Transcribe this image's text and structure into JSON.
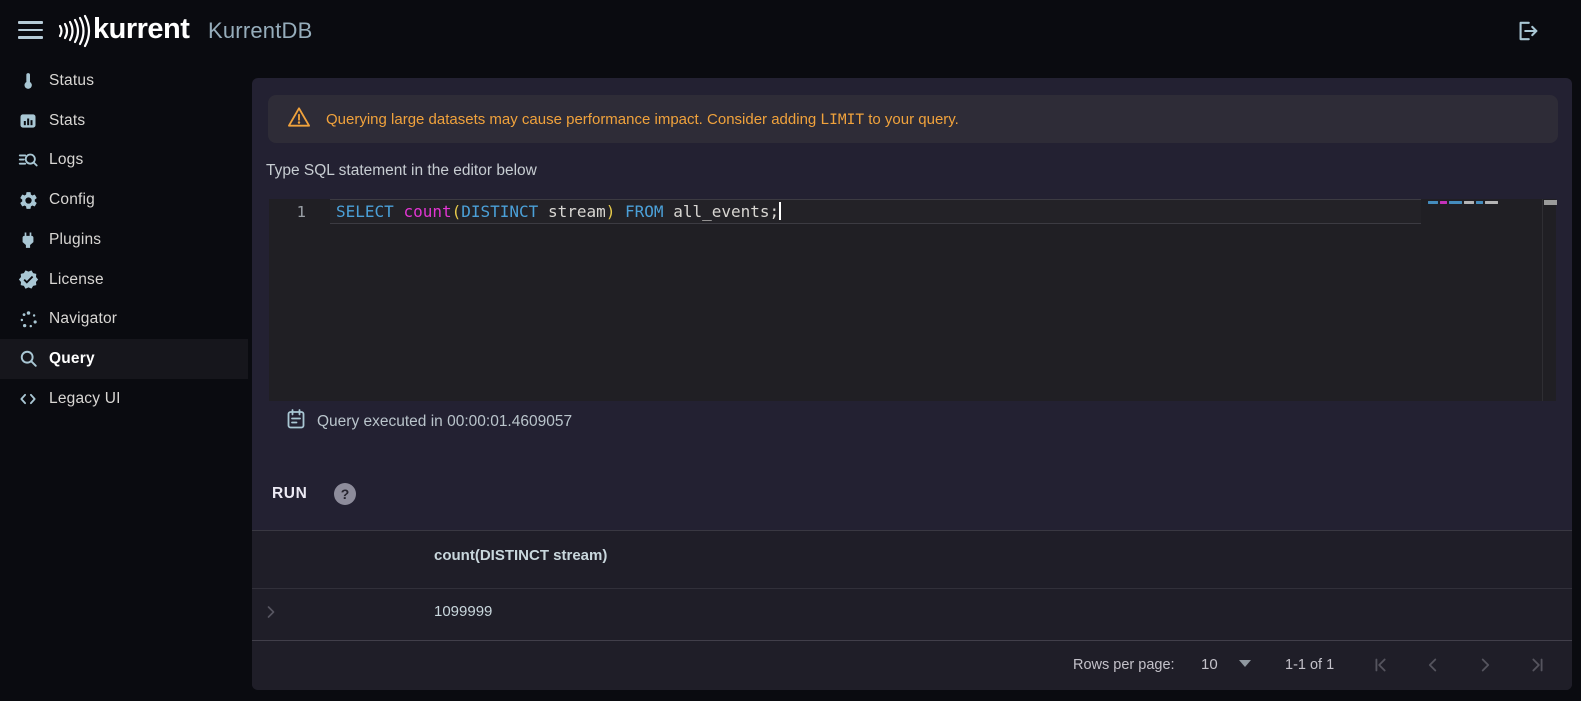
{
  "topbar": {
    "brand": "kurrent",
    "title": "KurrentDB"
  },
  "sidebar": {
    "items": [
      {
        "label": "Status",
        "icon": "thermometer-icon",
        "active": false
      },
      {
        "label": "Stats",
        "icon": "bar-chart-icon",
        "active": false
      },
      {
        "label": "Logs",
        "icon": "log-search-icon",
        "active": false
      },
      {
        "label": "Config",
        "icon": "gear-icon",
        "active": false
      },
      {
        "label": "Plugins",
        "icon": "plug-icon",
        "active": false
      },
      {
        "label": "License",
        "icon": "license-badge-icon",
        "active": false
      },
      {
        "label": "Navigator",
        "icon": "navigator-dots-icon",
        "active": false
      },
      {
        "label": "Query",
        "icon": "search-icon",
        "active": true
      },
      {
        "label": "Legacy UI",
        "icon": "code-brackets-icon",
        "active": false
      }
    ]
  },
  "banner": {
    "text_before": "Querying large datasets may cause performance impact. Consider adding ",
    "code": "LIMIT",
    "text_after": " to your query."
  },
  "editor": {
    "label": "Type SQL statement in the editor below",
    "line_number": "1",
    "tokens": [
      {
        "text": "SELECT ",
        "type": "keyword"
      },
      {
        "text": "count",
        "type": "function"
      },
      {
        "text": "(",
        "type": "paren"
      },
      {
        "text": "DISTINCT",
        "type": "keyword"
      },
      {
        "text": " stream",
        "type": "plain"
      },
      {
        "text": ")",
        "type": "paren"
      },
      {
        "text": " ",
        "type": "plain"
      },
      {
        "text": "FROM",
        "type": "keyword"
      },
      {
        "text": " all_events;",
        "type": "plain"
      }
    ],
    "minimap_marks": [
      {
        "w": 10,
        "c": "#4BA0D8"
      },
      {
        "w": 7,
        "c": "#E135D2"
      },
      {
        "w": 13,
        "c": "#4BA0D8"
      },
      {
        "w": 10,
        "c": "#cfcfcf"
      },
      {
        "w": 7,
        "c": "#4BA0D8"
      },
      {
        "w": 13,
        "c": "#cfcfcf"
      }
    ]
  },
  "status": {
    "text": "Query executed in 00:00:01.4609057"
  },
  "toolbar": {
    "run_label": "RUN",
    "help_label": "?"
  },
  "results": {
    "header": "count(DISTINCT stream)",
    "rows": [
      {
        "value": "1099999"
      }
    ]
  },
  "pagination": {
    "rows_per_page_label": "Rows per page:",
    "rows_per_page_value": "10",
    "range": "1-1 of 1"
  },
  "colors": {
    "page_bg": "#0a0b10",
    "panel_bg": "#232132",
    "results_bg": "#1f1e28",
    "banner_bg": "#2e2c37",
    "editor_bg": "#201f24",
    "warning": "#f0a23c",
    "icon_blue": "#a9c7d4",
    "keyword": "#4BA0D8",
    "function": "#E135D2",
    "paren": "#E4C84A",
    "code_plain": "#d8d6d2"
  }
}
